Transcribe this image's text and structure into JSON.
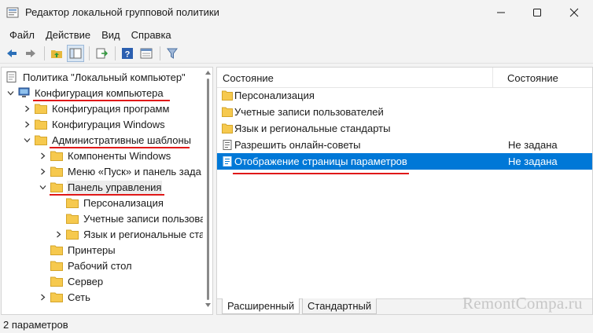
{
  "window": {
    "title": "Редактор локальной групповой политики"
  },
  "menu": {
    "items": [
      "Файл",
      "Действие",
      "Вид",
      "Справка"
    ]
  },
  "colors": {
    "selection": "#0078d7",
    "folder": "#f6c94e",
    "annotation": "#e01818"
  },
  "tree": {
    "root": "Политика \"Локальный компьютер\"",
    "computer_config": "Конфигурация компьютера",
    "programs_config": "Конфигурация программ",
    "windows_config": "Конфигурация Windows",
    "admin_templates": "Административные шаблоны",
    "windows_components": "Компоненты Windows",
    "start_menu": "Меню «Пуск» и панель зада",
    "control_panel": "Панель управления",
    "personalization": "Персонализация",
    "user_accounts": "Учетные записи пользова",
    "language": "Язык и региональные ста",
    "printers": "Принтеры",
    "desktop": "Рабочий стол",
    "server": "Сервер",
    "network": "Сеть"
  },
  "list": {
    "header_name": "Состояние",
    "header_state": "Состояние",
    "rows": [
      {
        "label": "Персонализация",
        "state": "",
        "icon": "folder-icon"
      },
      {
        "label": "Учетные записи пользователей",
        "state": "",
        "icon": "folder-icon"
      },
      {
        "label": "Язык и региональные стандарты",
        "state": "",
        "icon": "folder-icon"
      },
      {
        "label": "Разрешить онлайн-советы",
        "state": "Не задана",
        "icon": "policy-icon"
      },
      {
        "label": "Отображение страницы параметров",
        "state": "Не задана",
        "icon": "policy-icon"
      }
    ]
  },
  "tabs": [
    "Расширенный",
    "Стандартный"
  ],
  "status": {
    "text": "2 параметров"
  },
  "watermark": "RemontCompa.ru"
}
